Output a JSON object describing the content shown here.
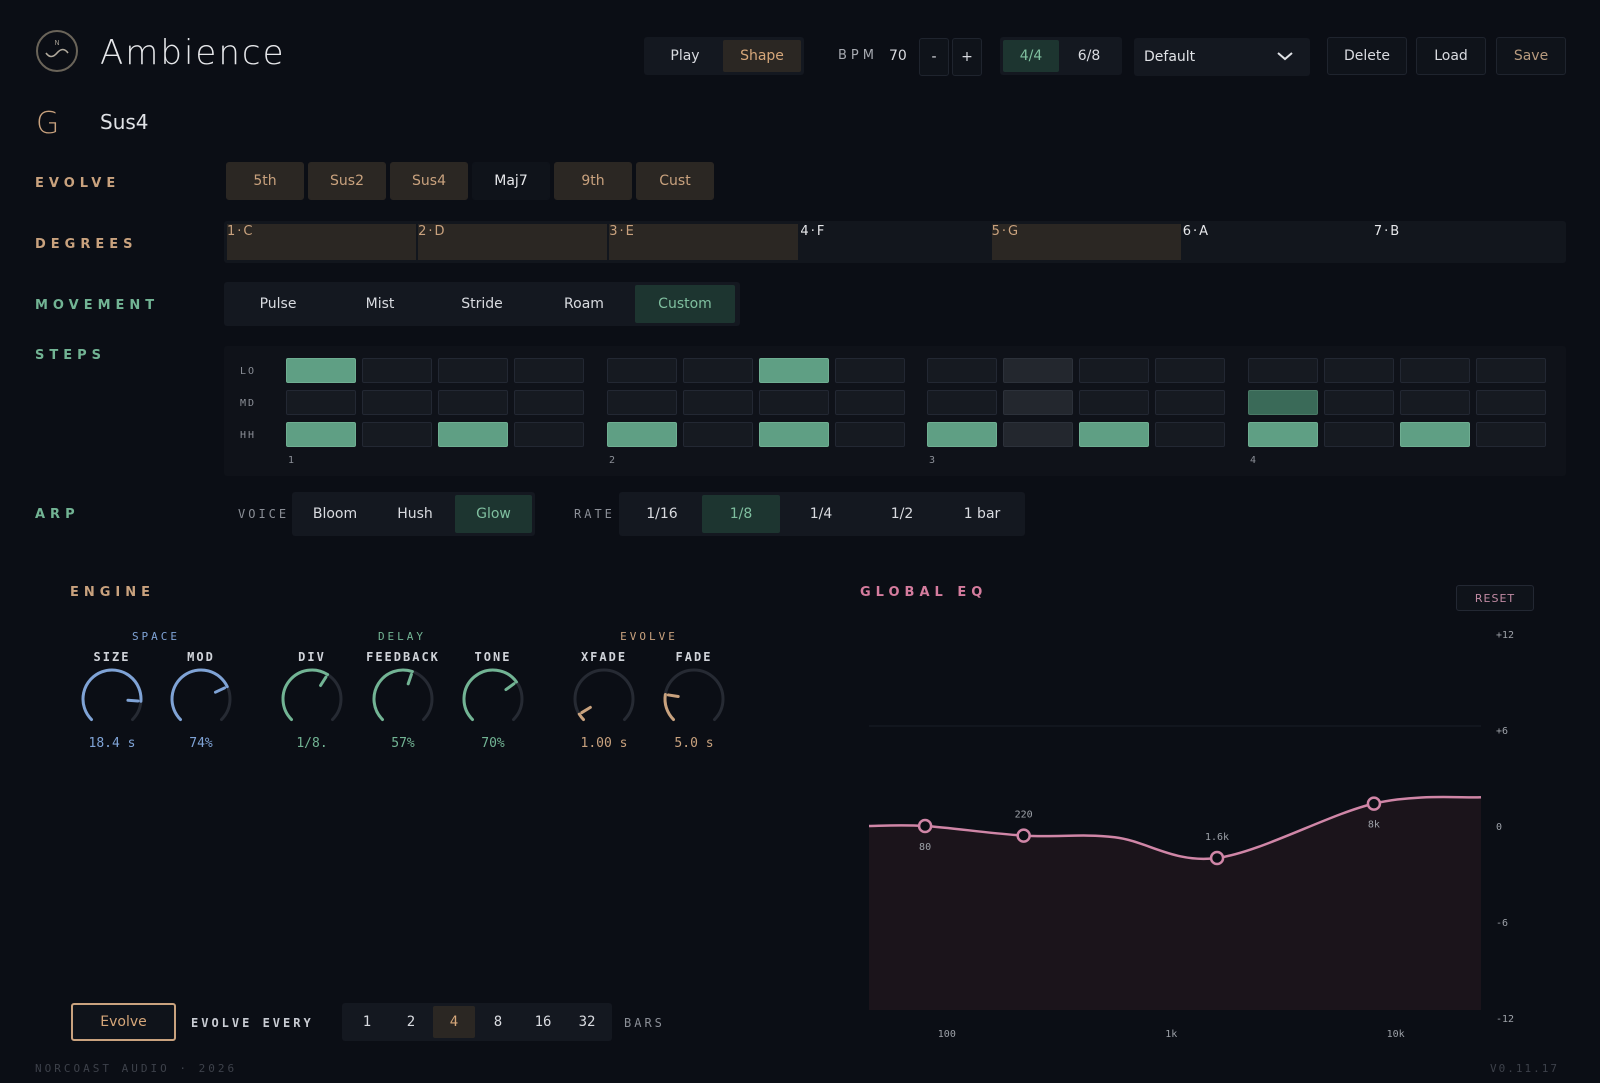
{
  "app": {
    "title": "Ambience"
  },
  "header": {
    "mode": {
      "options": [
        "Play",
        "Shape"
      ],
      "selected": "Shape"
    },
    "bpm": {
      "label": "BPM",
      "value": "70",
      "minus": "-",
      "plus": "+"
    },
    "meter": {
      "options": [
        "4/4",
        "6/8"
      ],
      "selected": "4/4"
    },
    "preset": {
      "value": "Default"
    },
    "actions": {
      "delete": "Delete",
      "load": "Load",
      "save": "Save"
    }
  },
  "chord": {
    "key": "G",
    "name": "Sus4"
  },
  "evolve_row": {
    "label": "EVOLVE",
    "options": [
      "5th",
      "Sus2",
      "Sus4",
      "Maj7",
      "9th",
      "Cust"
    ],
    "active": [
      "5th",
      "Sus2",
      "Sus4",
      "9th",
      "Cust"
    ]
  },
  "degrees": {
    "label": "DEGREES",
    "options": [
      "1·C",
      "2·D",
      "3·E",
      "4·F",
      "5·G",
      "6·A",
      "7·B"
    ],
    "active": [
      "1·C",
      "2·D",
      "3·E",
      "5·G"
    ]
  },
  "movement": {
    "label": "MOVEMENT",
    "options": [
      "Pulse",
      "Mist",
      "Stride",
      "Roam",
      "Custom"
    ],
    "selected": "Custom"
  },
  "steps": {
    "label": "STEPS",
    "lanes": [
      "LO",
      "MD",
      "HH"
    ],
    "beats": [
      "1",
      "2",
      "3",
      "4"
    ],
    "grid": {
      "LO": [
        1,
        0,
        0,
        0,
        0,
        0,
        1,
        0,
        0,
        2,
        0,
        0,
        0,
        0,
        0,
        0
      ],
      "MD": [
        0,
        0,
        0,
        0,
        0,
        0,
        0,
        0,
        0,
        2,
        0,
        0,
        3,
        0,
        0,
        0
      ],
      "HH": [
        1,
        0,
        1,
        0,
        1,
        0,
        1,
        0,
        1,
        2,
        1,
        0,
        1,
        0,
        1,
        0
      ]
    }
  },
  "arp": {
    "label": "ARP",
    "voice_label": "VOICE",
    "voices": [
      "Bloom",
      "Hush",
      "Glow"
    ],
    "voice_selected": "Glow",
    "rate_label": "RATE",
    "rates": [
      "1/16",
      "1/8",
      "1/4",
      "1/2",
      "1 bar"
    ],
    "rate_selected": "1/8"
  },
  "engine": {
    "label": "ENGINE",
    "groups": [
      {
        "title": "SPACE",
        "color": "#7fa3d6",
        "knobs": [
          {
            "name": "SIZE",
            "value": "18.4 s",
            "level": 0.85
          },
          {
            "name": "MOD",
            "value": "74%",
            "level": 0.74
          }
        ]
      },
      {
        "title": "DELAY",
        "color": "#72b494",
        "knobs": [
          {
            "name": "DIV",
            "value": "1/8.",
            "level": 0.62
          },
          {
            "name": "FEEDBACK",
            "value": "57%",
            "level": 0.57
          },
          {
            "name": "TONE",
            "value": "70%",
            "level": 0.7
          }
        ]
      },
      {
        "title": "EVOLVE",
        "color": "#c9a27e",
        "knobs": [
          {
            "name": "XFADE",
            "value": "1.00 s",
            "level": 0.05
          },
          {
            "name": "FADE",
            "value": "5.0 s",
            "level": 0.2
          }
        ]
      }
    ]
  },
  "eq": {
    "label": "GLOBAL EQ",
    "reset": "RESET",
    "db_ticks": [
      "+12",
      "+6",
      "0",
      "-6",
      "-12"
    ],
    "freq_ticks": [
      "100",
      "1k",
      "10k"
    ],
    "bands": [
      {
        "freq": 80,
        "label": "80",
        "gain": 0.0
      },
      {
        "freq": 220,
        "label": "220",
        "gain": -0.6
      },
      {
        "freq": 1600,
        "label": "1.6k",
        "gain": -2.0
      },
      {
        "freq": 8000,
        "label": "8k",
        "gain": 1.4
      }
    ]
  },
  "evolve_every": {
    "button": "Evolve",
    "label": "EVOLVE EVERY",
    "options": [
      "1",
      "2",
      "4",
      "8",
      "16",
      "32"
    ],
    "selected": "4",
    "unit": "BARS"
  },
  "footer": {
    "left": "NORCOAST AUDIO · 2026",
    "right": "V0.11.17"
  }
}
